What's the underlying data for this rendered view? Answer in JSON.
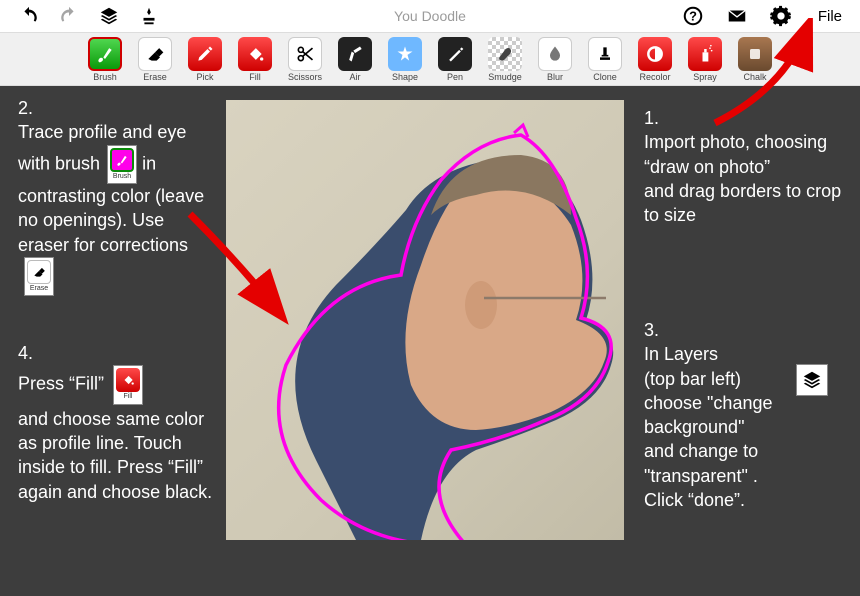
{
  "topbar": {
    "title": "You Doodle",
    "file": "File"
  },
  "tools": [
    {
      "id": "brush",
      "label": "Brush",
      "cls": "ic-green"
    },
    {
      "id": "erase",
      "label": "Erase",
      "cls": "ic-white"
    },
    {
      "id": "pick",
      "label": "Pick",
      "cls": "ic-red"
    },
    {
      "id": "fill",
      "label": "Fill",
      "cls": "ic-red"
    },
    {
      "id": "scissors",
      "label": "Scissors",
      "cls": "ic-white"
    },
    {
      "id": "air",
      "label": "Air",
      "cls": "ic-black"
    },
    {
      "id": "shape",
      "label": "Shape",
      "cls": "ic-blue"
    },
    {
      "id": "pen",
      "label": "Pen",
      "cls": "ic-black"
    },
    {
      "id": "smudge",
      "label": "Smudge",
      "cls": "ic-checker"
    },
    {
      "id": "blur",
      "label": "Blur",
      "cls": "ic-white"
    },
    {
      "id": "clone",
      "label": "Clone",
      "cls": "ic-white"
    },
    {
      "id": "recolor",
      "label": "Recolor",
      "cls": "ic-red"
    },
    {
      "id": "spray",
      "label": "Spray",
      "cls": "ic-red"
    },
    {
      "id": "chalk",
      "label": "Chalk",
      "cls": "ic-brown"
    }
  ],
  "step1": {
    "num": "1.",
    "text": "Import photo, choosing “draw on photo”\nand drag borders to crop to size"
  },
  "step2": {
    "num": "2.",
    "text_a": "Trace profile and eye with brush",
    "text_b": "in contrasting color (leave no openings). Use eraser for corrections",
    "brush_lbl": "Brush",
    "erase_lbl": "Erase"
  },
  "step3": {
    "num": "3.",
    "text": "In Layers\n(top bar left)\nchoose \"change background\"\n and change to \"transparent\" .\nClick “done”."
  },
  "step4": {
    "num": "4.",
    "text_a": "Press “Fill”",
    "text_b": "and choose same color as profile line. Touch inside to fill. Press “Fill” again and choose black.",
    "fill_lbl": "Fill"
  }
}
